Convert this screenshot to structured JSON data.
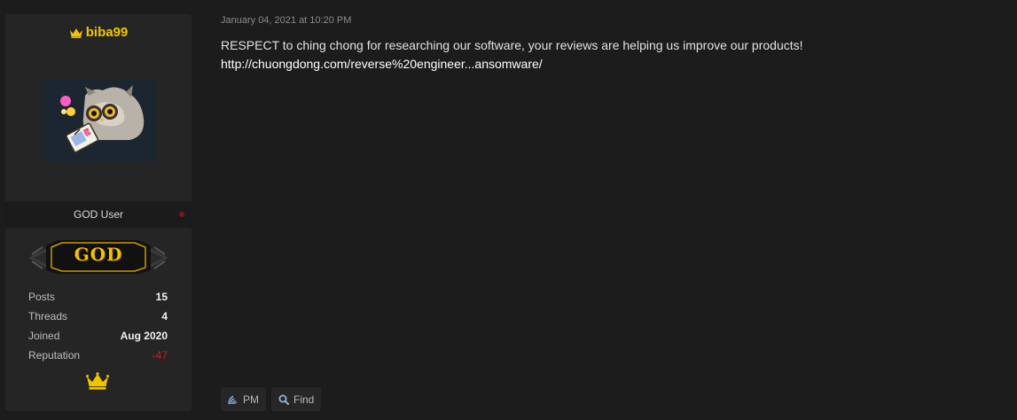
{
  "user": {
    "username": "biba99",
    "group": "GOD User",
    "rank_badge": "GOD",
    "stats": [
      {
        "label": "Posts",
        "value": "15"
      },
      {
        "label": "Threads",
        "value": "4"
      },
      {
        "label": "Joined",
        "value": "Aug 2020"
      },
      {
        "label": "Reputation",
        "value": "-47"
      }
    ],
    "icons": {
      "username_icon": "crown-icon",
      "status": "offline-dot-icon",
      "award": "crown-icon"
    }
  },
  "post": {
    "date": "January 04, 2021 at 10:20 PM",
    "message": "RESPECT to ching chong for researching our software, your reviews are helping us improve our products!",
    "link_text": "http://chuongdong.com/reverse%20engineer...ansomware/"
  },
  "actions": {
    "pm_label": "PM",
    "find_label": "Find",
    "pm_icon": "message-icon",
    "find_icon": "search-icon"
  },
  "colors": {
    "background": "#1c1c1c",
    "panel": "#252525",
    "username": "#f2c400",
    "reputation_negative": "#c42020"
  }
}
